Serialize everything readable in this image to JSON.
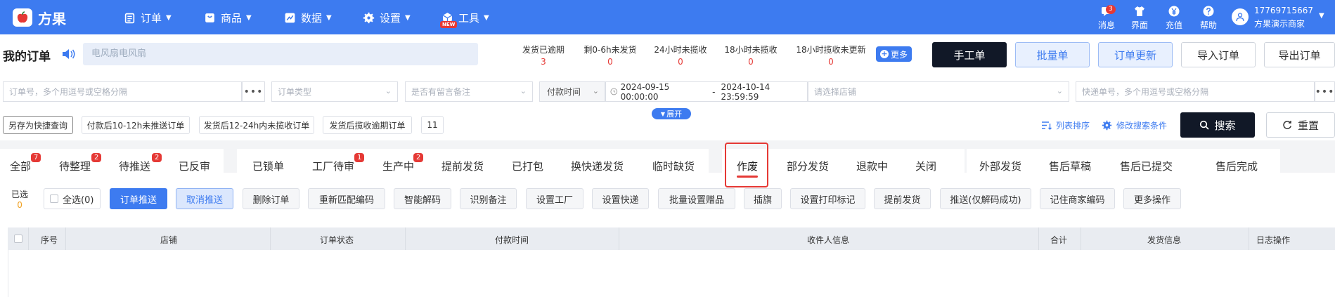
{
  "app": {
    "brand": "方果"
  },
  "nav": {
    "items": [
      {
        "label": "订单",
        "icon": "clipboard-icon"
      },
      {
        "label": "商品",
        "icon": "bag-icon"
      },
      {
        "label": "数据",
        "icon": "chart-icon"
      },
      {
        "label": "设置",
        "icon": "gear-icon"
      },
      {
        "label": "工具",
        "icon": "cube-icon",
        "badge": "NEW"
      }
    ]
  },
  "top_icons": [
    {
      "label": "消息",
      "icon": "message-icon",
      "badge": "3"
    },
    {
      "label": "界面",
      "icon": "shirt-icon"
    },
    {
      "label": "充值",
      "icon": "yen-icon"
    },
    {
      "label": "帮助",
      "icon": "help-icon"
    }
  ],
  "user": {
    "phone": "17769715667",
    "name": "方果演示商家"
  },
  "title": "我的订单",
  "marquee": "电风扇电风扇",
  "stats": [
    {
      "label": "发货已逾期",
      "value": "3"
    },
    {
      "label": "剩0-6h未发货",
      "value": "0"
    },
    {
      "label": "24小时未揽收",
      "value": "0"
    },
    {
      "label": "18小时未揽收",
      "value": "0"
    },
    {
      "label": "18小时揽收未更新",
      "value": "0"
    }
  ],
  "more_label": "更多",
  "header_buttons": {
    "manual": "手工单",
    "batch": "批量单",
    "update": "订单更新",
    "import": "导入订单",
    "export": "导出订单"
  },
  "filters": {
    "order_no_placeholder": "订单号，多个用逗号或空格分隔",
    "dots": "•••",
    "order_type_placeholder": "订单类型",
    "remark_placeholder": "是否有留言备注",
    "time_type": "付款时间",
    "date_start": "2024-09-15 00:00:00",
    "date_sep": "-",
    "date_end": "2024-10-14 23:59:59",
    "shop_placeholder": "请选择店铺",
    "express_placeholder": "快递单号，多个用逗号或空格分隔"
  },
  "expand_label": "展开",
  "quick": {
    "save_label": "另存为快捷查询",
    "items": [
      "付款后10-12h未推送订单",
      "发货后12-24h内未揽收订单",
      "发货后揽收逾期订单"
    ],
    "count": "11"
  },
  "list_sort": "列表排序",
  "edit_conditions": "修改搜索条件",
  "search_label": "搜索",
  "reset_label": "重置",
  "tabs": [
    {
      "label": "全部",
      "badge": "7"
    },
    {
      "label": "待整理",
      "badge": "2"
    },
    {
      "label": "待推送",
      "badge": "2"
    },
    {
      "label": "已反审"
    },
    {
      "label": "已锁单"
    },
    {
      "label": "工厂待审",
      "badge": "1"
    },
    {
      "label": "生产中",
      "badge": "2"
    },
    {
      "label": "提前发货"
    },
    {
      "label": "已打包"
    },
    {
      "label": "换快递发货"
    },
    {
      "label": "临时缺货"
    },
    {
      "label": "作废",
      "active": true
    },
    {
      "label": "部分发货"
    },
    {
      "label": "退款中"
    },
    {
      "label": "关闭"
    },
    {
      "label": "外部发货"
    },
    {
      "label": "售后草稿"
    },
    {
      "label": "售后已提交"
    },
    {
      "label": "售后完成"
    }
  ],
  "selection": {
    "label": "已选",
    "count": "0",
    "select_all": "全选(0)"
  },
  "actions": [
    "订单推送",
    "取消推送",
    "删除订单",
    "重新匹配编码",
    "智能解码",
    "识别备注",
    "设置工厂",
    "设置快递",
    "批量设置赠品",
    "插旗",
    "设置打印标记",
    "提前发货",
    "推送(仅解码成功)",
    "记住商家编码",
    "更多操作"
  ],
  "columns": [
    "序号",
    "店铺",
    "订单状态",
    "付款时间",
    "收件人信息",
    "合计",
    "发货信息",
    "日志操作"
  ],
  "colors": {
    "primary": "#3d7bf0",
    "danger": "#e53935",
    "dark": "#111827"
  }
}
